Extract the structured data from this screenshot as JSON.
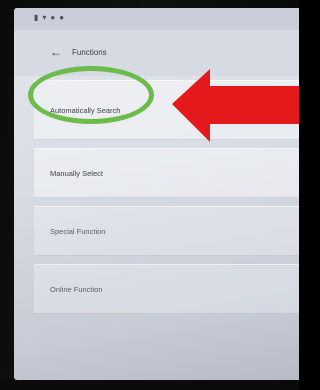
{
  "screen": {
    "title": "Functions",
    "items": [
      {
        "label": "Automatically Search"
      },
      {
        "label": "Manually Select"
      },
      {
        "label": "Special Function"
      },
      {
        "label": "Online Function"
      }
    ]
  },
  "annotations": {
    "highlight_color": "#6dbb4b",
    "arrow_color": "#e3191b"
  },
  "icons": {
    "back": "arrow-left-icon",
    "status": [
      "signal-icon",
      "battery-icon",
      "wifi-icon",
      "alarm-icon"
    ]
  }
}
